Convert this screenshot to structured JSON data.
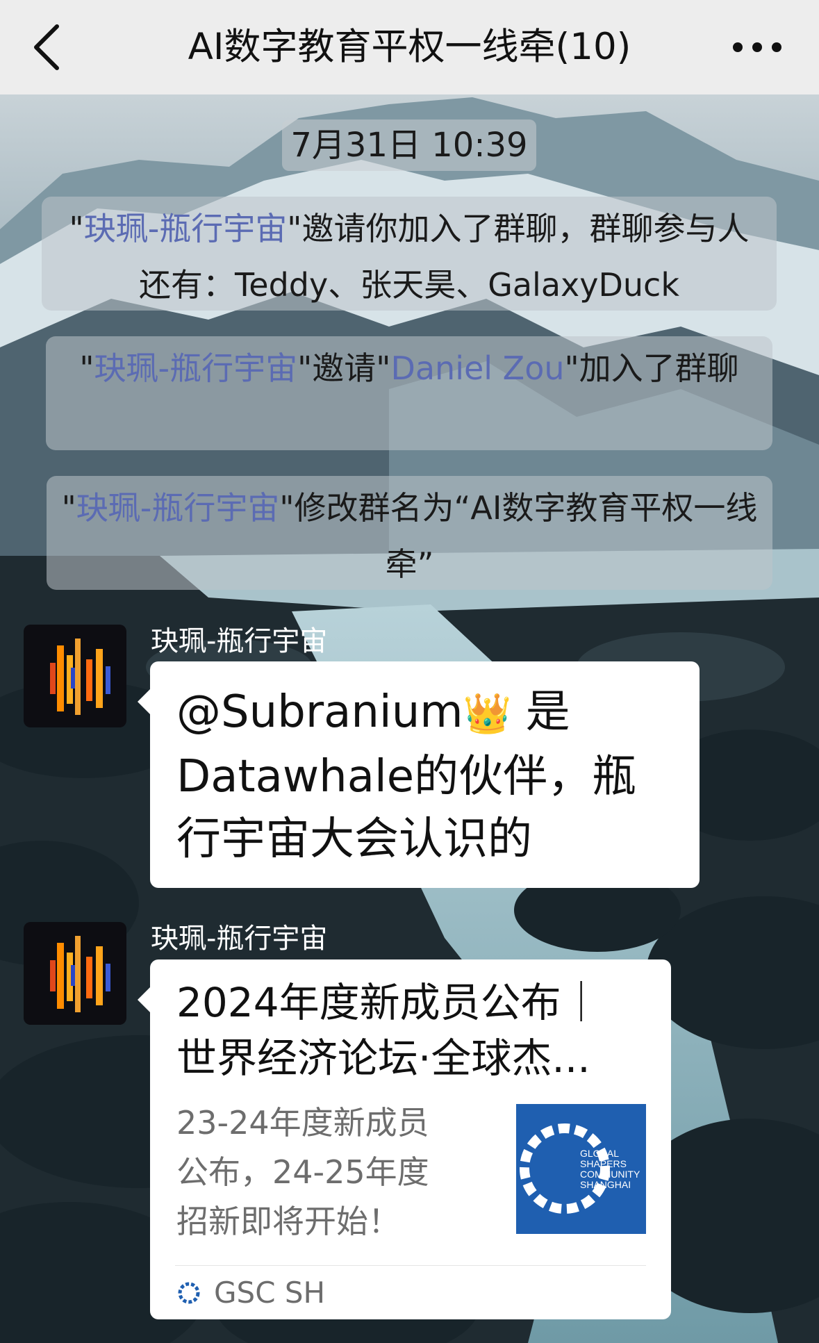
{
  "header": {
    "title": "AI数字教育平权一线牵(10)",
    "back_icon": "chevron-left-icon",
    "more_icon": "more-dots-icon"
  },
  "chat": {
    "timestamp": "7月31日 10:39",
    "notices": [
      {
        "q1": "\"",
        "inviter": "玦珮-瓶行宇宙",
        "rest": "\"邀请你加入了群聊，群聊参与人还有：Teddy、张天昊、GalaxyDuck"
      },
      {
        "q1": "\"",
        "inviter": "玦珮-瓶行宇宙",
        "mid": "\"邀请\"",
        "invitee": "Daniel Zou",
        "rest": "\"加入了群聊"
      },
      {
        "q1": "\"",
        "inviter": "玦珮-瓶行宇宙",
        "rest": "\"修改群名为“AI数字教育平权一线牵”"
      }
    ],
    "messages": [
      {
        "sender": "玦珮-瓶行宇宙",
        "text_pre": "@Subranium",
        "emoji": "👑",
        "text_post": " 是Datawhale的伙伴，瓶行宇宙大会认识的"
      },
      {
        "sender": "玦珮-瓶行宇宙",
        "card": {
          "title_line1": "2024年度新成员公布｜",
          "title_line2": "世界经济论坛·全球杰...",
          "desc_line1": "23-24年度新成员",
          "desc_line2": "公布，24-25年度",
          "desc_line3": "招新即将开始！",
          "thumb_text": [
            "GLOBAL",
            "SHAPERS",
            "COMMUNITY",
            "SHANGHAI"
          ],
          "source": "GSC SH"
        }
      }
    ]
  },
  "colors": {
    "header_bg": "#ededed",
    "link": "#5b6bb3",
    "bubble": "#ffffff",
    "thumb_blue": "#1f5fb0"
  }
}
